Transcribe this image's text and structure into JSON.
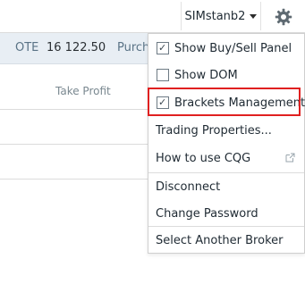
{
  "header": {
    "account_label": "SIMstanb2",
    "settings_icon": "gear-icon"
  },
  "infobar": {
    "ote_label": "OTE",
    "ote_value": "16 122.50",
    "purchase_label": "Purch"
  },
  "table": {
    "take_profit_header": "Take Profit"
  },
  "menu": {
    "items": [
      {
        "label": "Show Buy/Sell Panel",
        "checked": true
      },
      {
        "label": "Show DOM",
        "checked": false
      },
      {
        "label": "Brackets Management",
        "checked": true
      },
      {
        "label": "Trading Properties..."
      },
      {
        "label": "How to use CQG",
        "icon": "external-link-icon"
      },
      {
        "label": "Disconnect"
      },
      {
        "label": "Change Password"
      },
      {
        "label": "Select Another Broker"
      }
    ],
    "highlight_color": "#e02020"
  }
}
